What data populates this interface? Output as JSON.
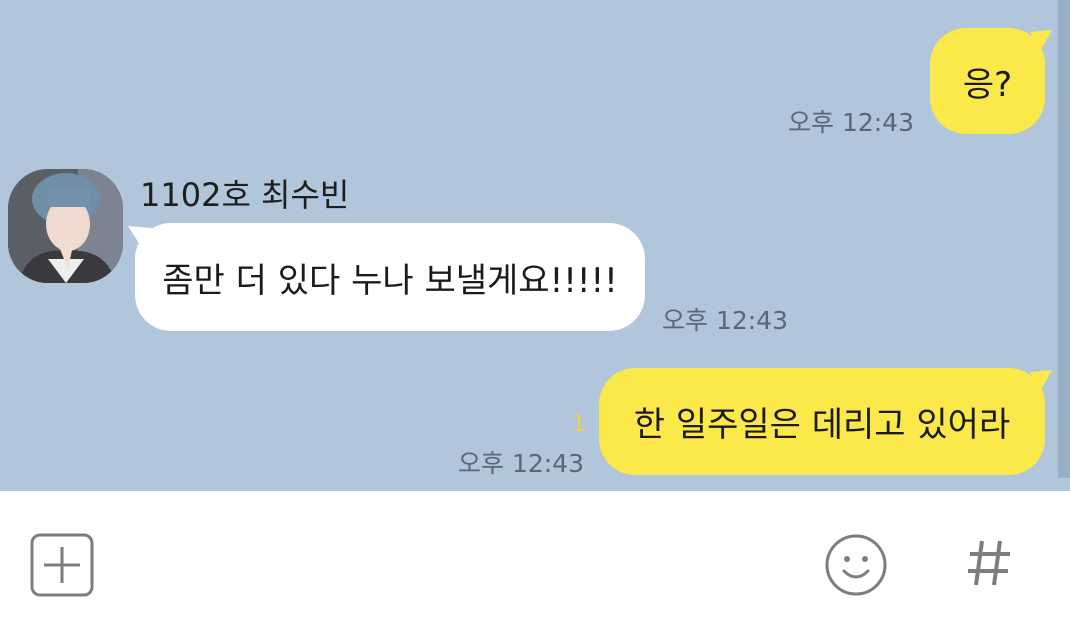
{
  "chat": {
    "messages": [
      {
        "from": "me",
        "text": "응?",
        "time": "오후 12:43"
      },
      {
        "from": "other",
        "sender": "1102호 최수빈",
        "text": "좀만 더 있다 누나 보낼게요!!!!!",
        "time": "오후 12:43"
      },
      {
        "from": "me",
        "text": "한 일주일은 데리고 있어라",
        "time": "오후 12:43",
        "unread_count": "1"
      }
    ]
  },
  "input_bar": {
    "add_icon": "plus-square-icon",
    "emoji_icon": "smiley-icon",
    "hash_icon": "hash-icon"
  },
  "colors": {
    "chat_background": "#b1c5db",
    "my_bubble": "#fbe84a",
    "other_bubble": "#ffffff",
    "unread": "#f0d23a"
  }
}
